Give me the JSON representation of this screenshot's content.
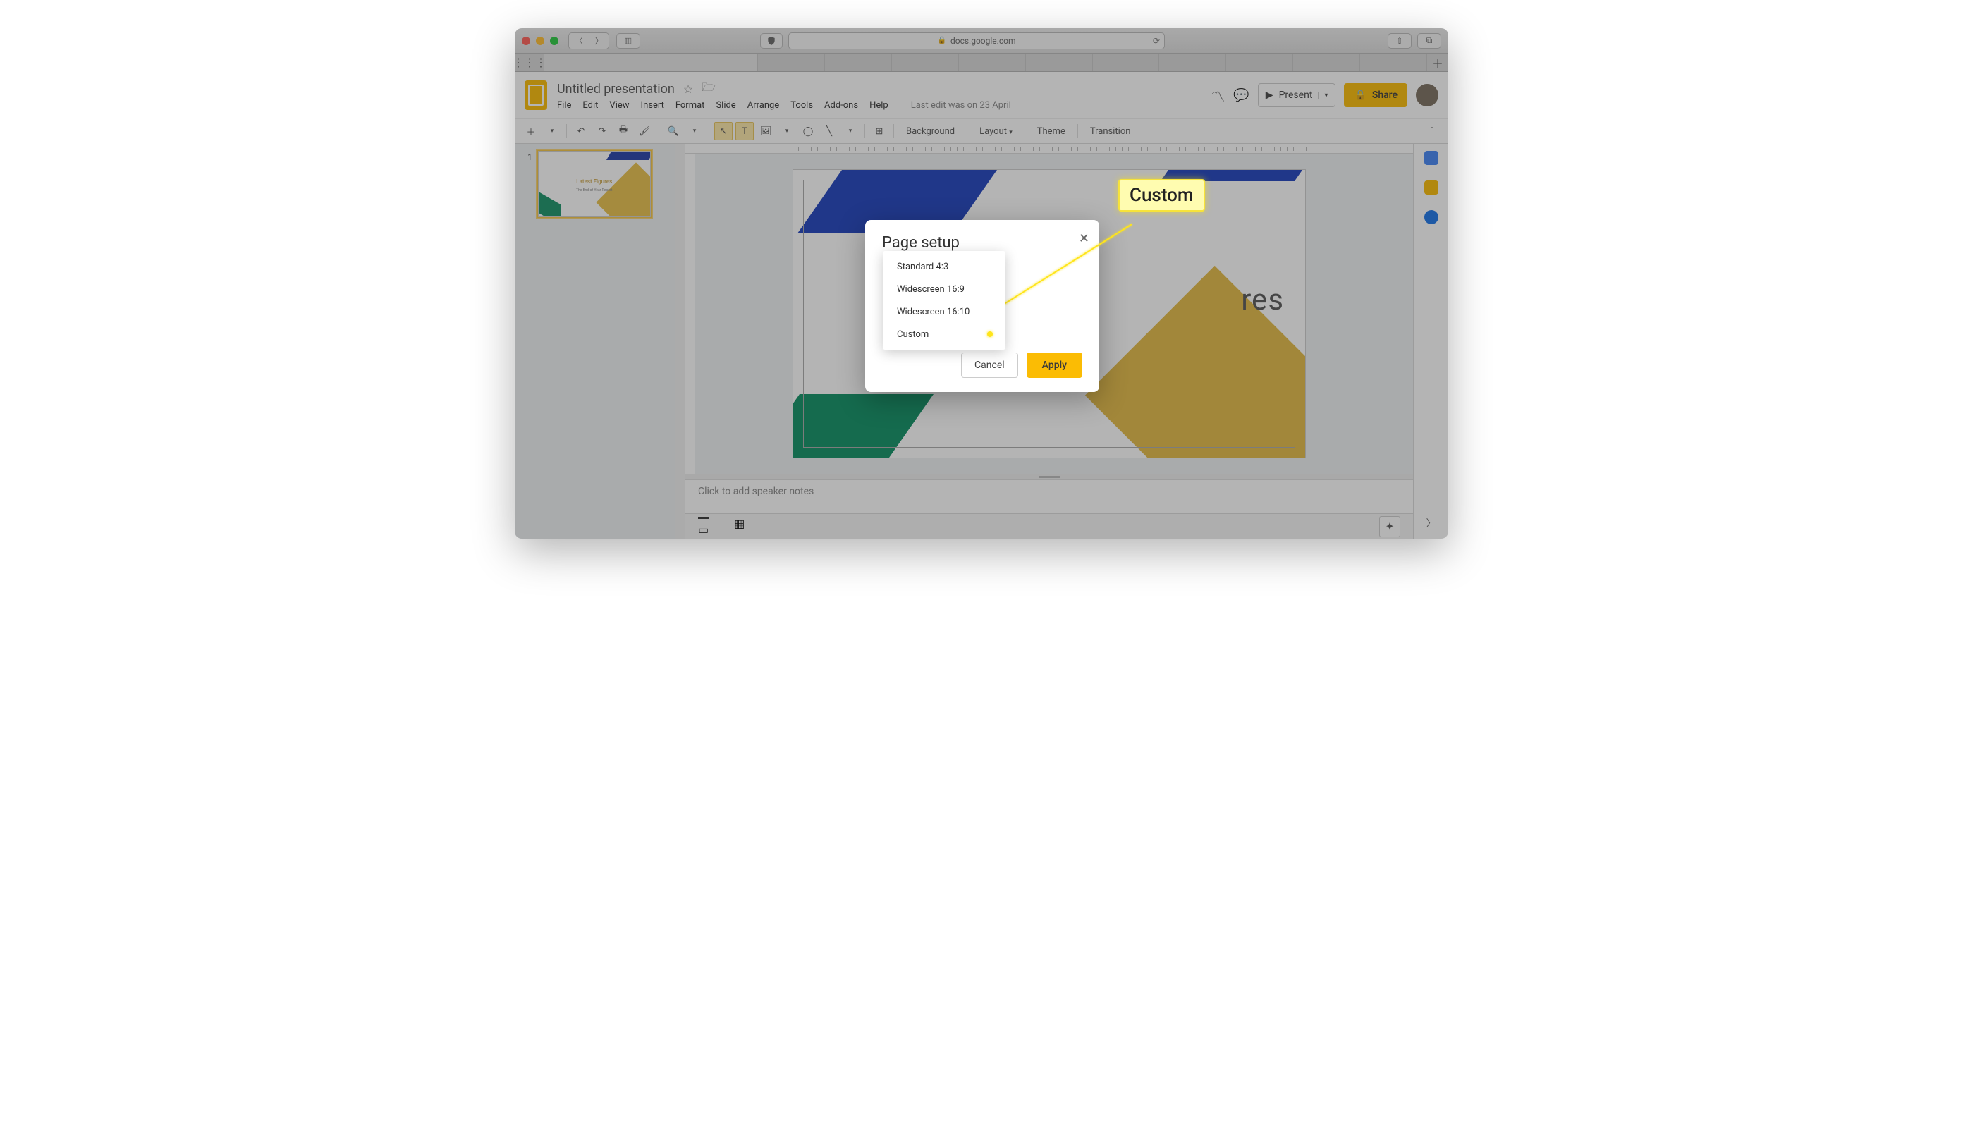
{
  "browser": {
    "url": "docs.google.com",
    "traffic": {
      "close": "#ff5f57",
      "min": "#ffbd2e",
      "max": "#28c940"
    }
  },
  "doc": {
    "title": "Untitled presentation",
    "menus": [
      "File",
      "Edit",
      "View",
      "Insert",
      "Format",
      "Slide",
      "Arrange",
      "Tools",
      "Add-ons",
      "Help"
    ],
    "last_edit": "Last edit was on 23 April",
    "present_label": "Present",
    "share_label": "Share"
  },
  "toolbar": {
    "background": "Background",
    "layout": "Layout",
    "theme": "Theme",
    "transition": "Transition"
  },
  "thumb": {
    "num": "1",
    "title": "Latest Figures",
    "subtitle": "The End-of-Year Report"
  },
  "slide": {
    "title_fragment": "res"
  },
  "notes_placeholder": "Click to add speaker notes",
  "dialog": {
    "title": "Page setup",
    "cancel": "Cancel",
    "apply": "Apply",
    "options": [
      "Standard 4:3",
      "Widescreen 16:9",
      "Widescreen 16:10",
      "Custom"
    ]
  },
  "callout": "Custom",
  "sidepanel": {
    "cal": "#4285f4",
    "keep": "#fbbc04",
    "tasks": "#1a73e8"
  }
}
